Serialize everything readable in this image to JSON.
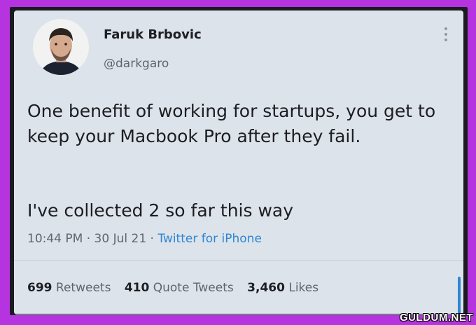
{
  "tweet": {
    "author_name": "Faruk Brbovic",
    "author_handle": "@darkgaro",
    "text_line1": "One benefit of working for startups, you get to keep your Macbook Pro after they fail.",
    "text_line2": "I've collected 2 so far this way",
    "time": "10:44 PM",
    "date": "30 Jul 21",
    "source": "Twitter for iPhone",
    "separator": "·"
  },
  "stats": {
    "retweets_count": "699",
    "retweets_label": "Retweets",
    "quotes_count": "410",
    "quotes_label": "Quote Tweets",
    "likes_count": "3,460",
    "likes_label": "Likes"
  },
  "watermark": "GULDUM.NET",
  "colors": {
    "border": "#b534e0",
    "card_bg": "#dde3ea",
    "link": "#2f86d3"
  }
}
